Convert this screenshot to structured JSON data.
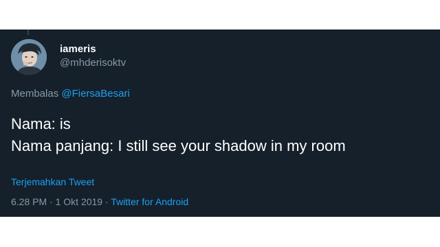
{
  "tweet": {
    "display_name": "iameris",
    "handle": "@mhderisoktv",
    "reply_prefix": "Membalas ",
    "reply_mention": "@FiersaBesari",
    "text_line1": "Nama: is",
    "text_line2": "Nama panjang: I still see your shadow in my room",
    "translate_label": "Terjemahkan Tweet",
    "time": "6.28 PM",
    "separator": " · ",
    "date": "1 Okt 2019",
    "source": "Twitter for Android",
    "avatar_icon": "profile-photo-avatar"
  },
  "colors": {
    "background": "#15202b",
    "text_primary": "#ffffff",
    "text_secondary": "#8899a6",
    "link": "#1da1f2"
  }
}
